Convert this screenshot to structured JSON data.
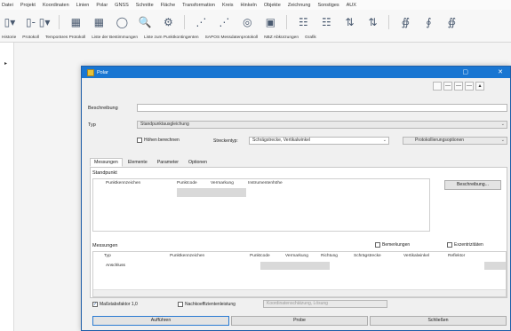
{
  "menu": [
    "Datei",
    "Projekt",
    "Koordinaten",
    "Linien",
    "Polar",
    "GNSS",
    "Schnitte",
    "Fläche",
    "Transformation",
    "Kreis",
    "Hinkeln",
    "Objekte",
    "Zeichnung",
    "Sonstiges",
    "AUX"
  ],
  "toolbar_icons": [
    "file-icon",
    "file-dropdown-icon",
    "file-dash-icon",
    "file-dropdown-2-icon",
    "blocks-icon",
    "blocks-2-icon",
    "circle-icon",
    "zoom-icon",
    "gear-icon",
    "points-icon",
    "points-2-icon",
    "target-icon",
    "grid-icon",
    "grid-2-icon",
    "grid-3-icon",
    "sort-icon",
    "sort-2-icon",
    "ax-icon",
    "ax-2-icon",
    "ay-icon"
  ],
  "app_tabs": [
    "Historie",
    "Protokoll",
    "Temporäres Protokoll",
    "Liste der Bestimmungen",
    "Liste zum Punktkontingenten",
    "SAPOS Messdatenprotokoll",
    "NBZ Abkürzungen",
    "Grafik"
  ],
  "dialog": {
    "title": "Polar",
    "labels": {
      "beschreibung": "Beschreibung",
      "typ": "Typ",
      "standpunkt": "Standpunkt",
      "messungen": "Messungen"
    },
    "typ_value": "Standpunktausgleichung",
    "hoehen_label": "Höhen berechnen",
    "streckentyp_label": "Streckentyp:",
    "streckentyp_value": "Schrägstrecke, Vertikalwinkel",
    "protokoll_button": "Protokollierungsoptionen",
    "tabs": [
      "Messungen",
      "Elemente",
      "Parameter",
      "Optionen"
    ],
    "standpunkt_columns": [
      "Punktkennzeichen",
      "Punktcode",
      "Vermarkung",
      "Instrumentenhöhe"
    ],
    "beschreibung_button": "Beschreibung...",
    "bemerkungen_label": "Bemerkungen",
    "exzentrizitaeten_label": "Exzentrizitäten",
    "messungen_columns": [
      "Typ",
      "Punktkennzeichen",
      "Punktcode",
      "Vermarkung",
      "Richtung",
      "Schrägstrecke",
      "Vertikalwinkel",
      "Reflektor"
    ],
    "messungen_row_type": "Anschluss",
    "massstab_label": "Maßstabsfaktor 1,0",
    "nachkoeff_label": "Nachkoeffizientenleistung",
    "nachkoeff_value": "Koordinatenschätzung, Lösung",
    "buttons": [
      "Aufführen",
      "Probe",
      "Schließen"
    ]
  }
}
